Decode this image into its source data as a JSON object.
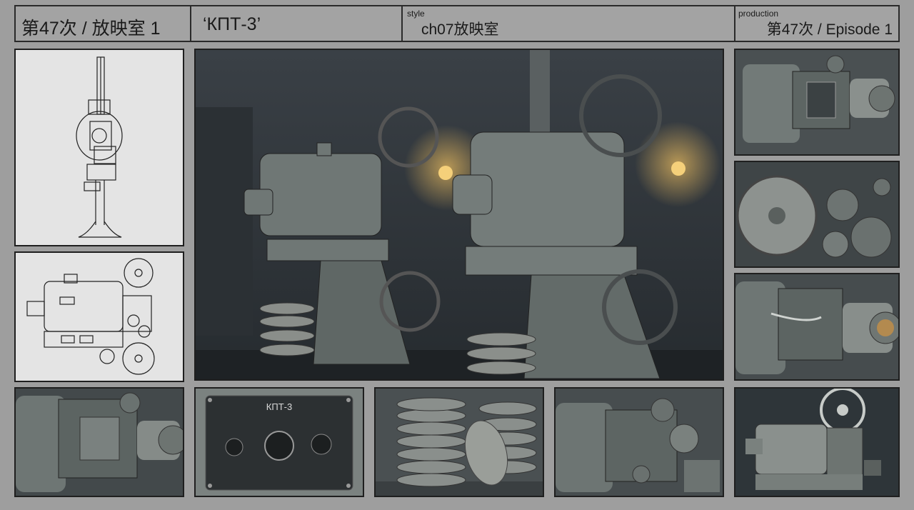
{
  "header": {
    "episode_title": "第47次 / 放映室 1",
    "subject": "‘КПТ-3’",
    "style_label": "style",
    "style_value": "ch07放映室",
    "production_label": "production",
    "production_value": "第47次 / Episode 1"
  },
  "panels": {
    "control_plate_label": "КПТ-3"
  },
  "colors": {
    "background": "#9e9e9e",
    "border": "#1f1f1f",
    "sketch_bg": "#e4e4e4",
    "metal": "#7d8583",
    "lamp_glow": "#f0c060"
  }
}
